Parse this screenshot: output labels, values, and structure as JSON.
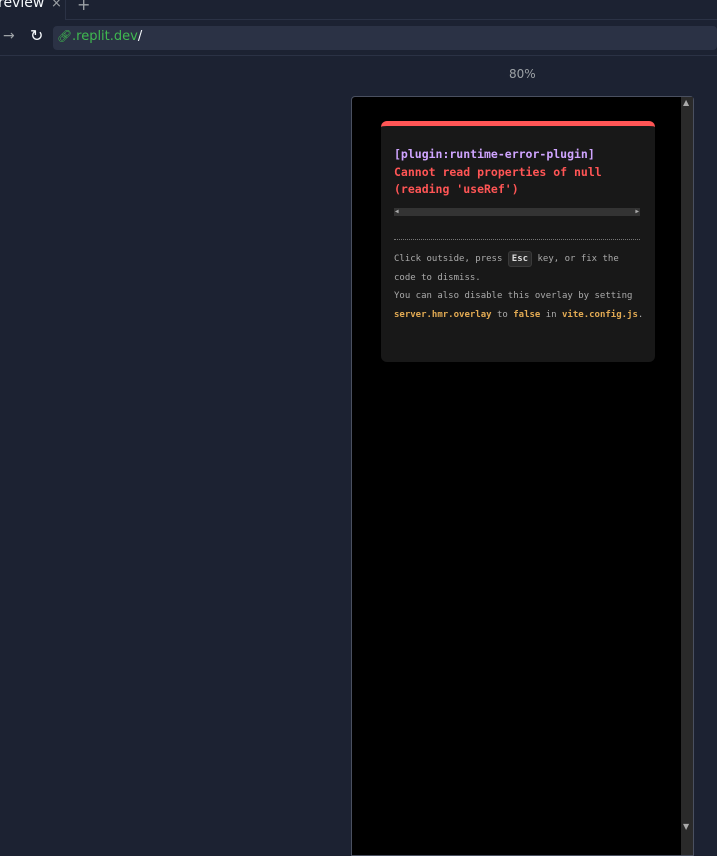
{
  "browser": {
    "tab_label": "review",
    "tab_close": "×",
    "tab_add": "+",
    "url_host": ".replit.dev",
    "url_path": "/",
    "zoom": "80%"
  },
  "overlay": {
    "accent_color": "#ff5555",
    "plugin": "[plugin:runtime-error-plugin]",
    "message": "Cannot read properties of null (reading 'useRef')",
    "tip_1a": "Click outside, press ",
    "tip_key": "Esc",
    "tip_1b": " key, or fix the code to dismiss.",
    "tip_2a": "You can also disable this overlay by setting ",
    "tip_code_1": "server.hmr.overlay",
    "tip_2b": " to ",
    "tip_code_2": "false",
    "tip_2c": " in ",
    "tip_code_3": "vite.config.js",
    "tip_2d": "."
  }
}
